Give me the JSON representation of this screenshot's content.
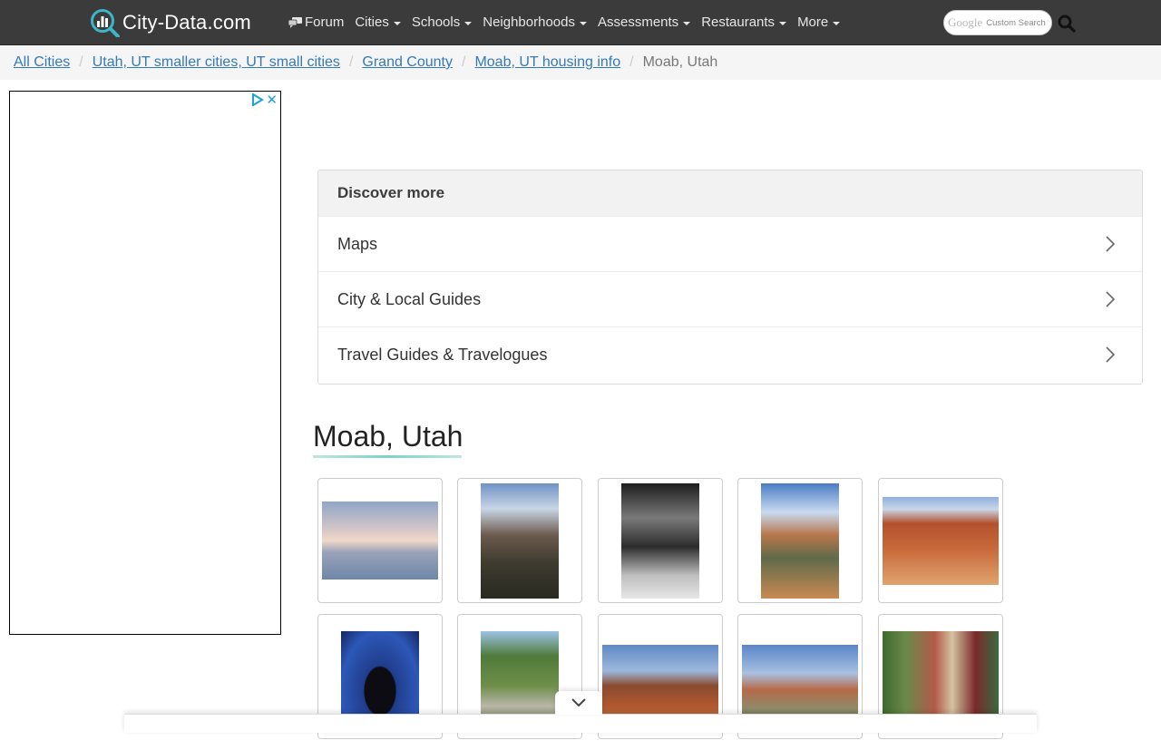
{
  "header": {
    "logo_text": "City-Data.com",
    "nav": [
      {
        "label": "Forum",
        "dropdown": false
      },
      {
        "label": "Cities",
        "dropdown": true
      },
      {
        "label": "Schools",
        "dropdown": true
      },
      {
        "label": "Neighborhoods",
        "dropdown": true
      },
      {
        "label": "Assessments",
        "dropdown": true
      },
      {
        "label": "Restaurants",
        "dropdown": true
      },
      {
        "label": "More",
        "dropdown": true
      }
    ],
    "search": {
      "google_label": "Google",
      "custom_label": "Custom Search"
    }
  },
  "breadcrumb": {
    "items": [
      "All Cities",
      "Utah, UT smaller cities, UT small cities",
      "Grand County",
      "Moab, UT housing info"
    ],
    "current": "Moab, Utah"
  },
  "ad": {
    "close_glyph": "✕"
  },
  "discover": {
    "title": "Discover more",
    "items": [
      "Maps",
      "City & Local Guides",
      "Travel Guides & Travelogues"
    ]
  },
  "page": {
    "title": "Moab, Utah"
  },
  "colors": {
    "navbar_bg": "#3b3b3b",
    "link": "#337ab7",
    "logo_accent": "#3cb6c7"
  },
  "photos": [
    {
      "name": "snowy-mountain-photo"
    },
    {
      "name": "rock-tower-photo"
    },
    {
      "name": "black-white-arch-photo"
    },
    {
      "name": "canyon-river-photo"
    },
    {
      "name": "red-canyon-road-photo"
    },
    {
      "name": "balanced-rock-silhouette-photo"
    },
    {
      "name": "park-path-photo"
    },
    {
      "name": "red-mesa-photo"
    },
    {
      "name": "desert-cliffs-photo"
    },
    {
      "name": "main-street-photo"
    }
  ]
}
